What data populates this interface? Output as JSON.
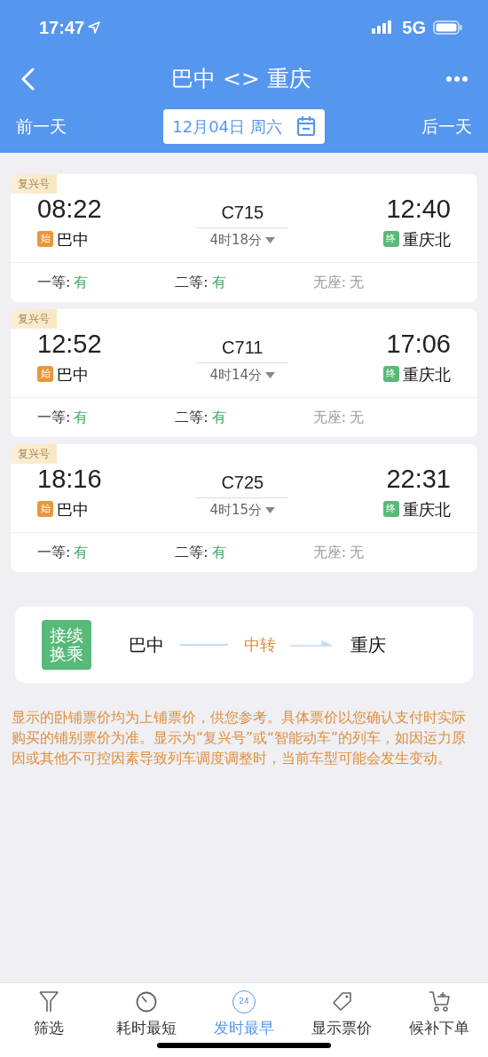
{
  "status_bar": {
    "time": "17:47",
    "network": "5G"
  },
  "header": {
    "title": "巴中 <> 重庆",
    "prev_day": "前一天",
    "date": "12月04日 周六",
    "next_day": "后一天"
  },
  "trains": [
    {
      "tag": "复兴号",
      "depart_time": "08:22",
      "train_no": "C715",
      "duration": "4时18分",
      "arrive_time": "12:40",
      "from_badge": "始",
      "from": "巴中",
      "to_badge": "终",
      "to": "重庆北",
      "seats": [
        {
          "label": "一等:",
          "value": "有",
          "available": true
        },
        {
          "label": "二等:",
          "value": "有",
          "available": true
        },
        {
          "label": "无座:",
          "value": "无",
          "available": false
        }
      ]
    },
    {
      "tag": "复兴号",
      "depart_time": "12:52",
      "train_no": "C711",
      "duration": "4时14分",
      "arrive_time": "17:06",
      "from_badge": "始",
      "from": "巴中",
      "to_badge": "终",
      "to": "重庆北",
      "seats": [
        {
          "label": "一等:",
          "value": "有",
          "available": true
        },
        {
          "label": "二等:",
          "value": "有",
          "available": true
        },
        {
          "label": "无座:",
          "value": "无",
          "available": false
        }
      ]
    },
    {
      "tag": "复兴号",
      "depart_time": "18:16",
      "train_no": "C725",
      "duration": "4时15分",
      "arrive_time": "22:31",
      "from_badge": "始",
      "from": "巴中",
      "to_badge": "终",
      "to": "重庆北",
      "seats": [
        {
          "label": "一等:",
          "value": "有",
          "available": true
        },
        {
          "label": "二等:",
          "value": "有",
          "available": true
        },
        {
          "label": "无座:",
          "value": "无",
          "available": false
        }
      ]
    }
  ],
  "transfer": {
    "badge": "接续换乘",
    "from": "巴中",
    "via": "中转",
    "to": "重庆"
  },
  "notice": "显示的卧铺票价均为上铺票价，供您参考。具体票价以您确认支付时实际购买的铺别票价为准。显示为“复兴号”或“智能动车”的列车，如因运力原因或其他不可控因素导致列车调度调整时，当前车型可能会发生变动。",
  "tab_bar": [
    {
      "kind": "filter",
      "label": "筛选",
      "selected": false
    },
    {
      "kind": "timer",
      "label": "耗时最短",
      "selected": false
    },
    {
      "kind": "clock24",
      "label": "发时最早",
      "icon_text": "24",
      "selected": true
    },
    {
      "kind": "tag",
      "label": "显示票价",
      "selected": false
    },
    {
      "kind": "cart",
      "label": "候补下单",
      "selected": false
    }
  ]
}
